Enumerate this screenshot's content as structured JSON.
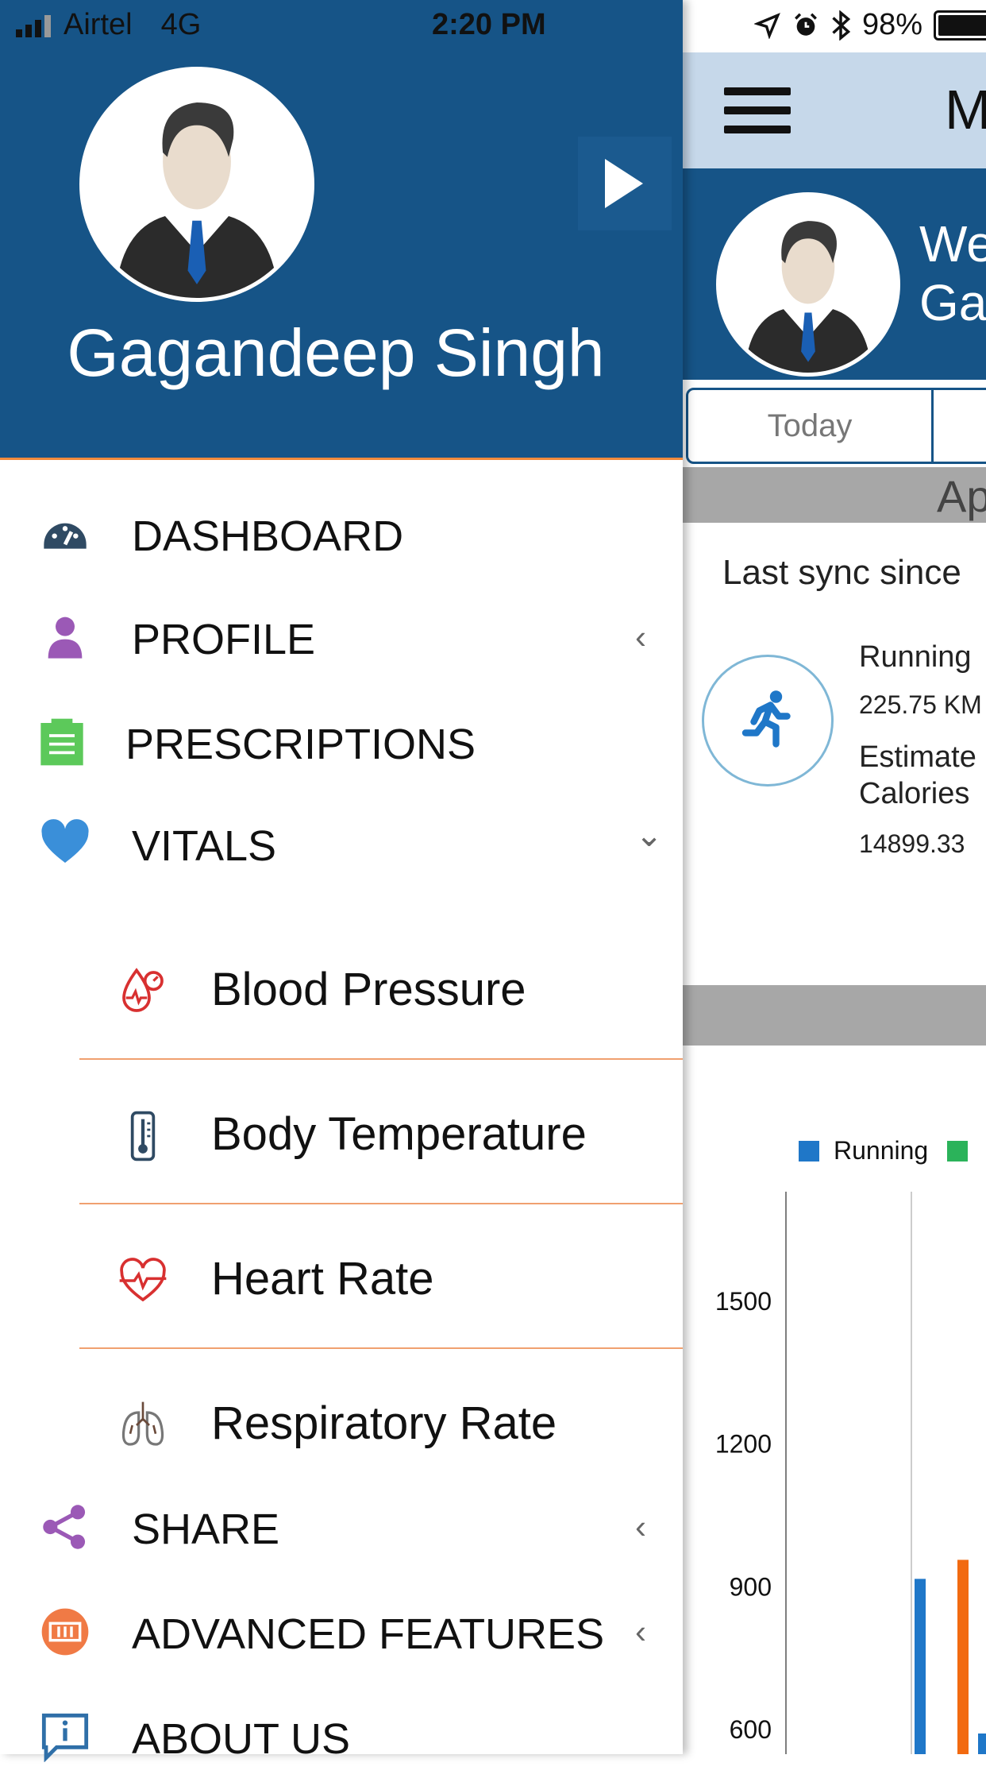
{
  "status_bar": {
    "carrier": "Airtel",
    "network": "4G",
    "time": "2:20 PM",
    "battery": "98%"
  },
  "drawer": {
    "user_name": "Gagandeep Singh",
    "menu": [
      {
        "label": "DASHBOARD",
        "icon": "dashboard-gauge-icon",
        "color": "#2f4a63"
      },
      {
        "label": "PROFILE",
        "icon": "person-icon",
        "color": "#9b59b6",
        "chevron": "‹"
      },
      {
        "label": "PRESCRIPTIONS",
        "icon": "clipboard-icon",
        "color": "#5cc95a"
      },
      {
        "label": "VITALS",
        "icon": "heart-icon",
        "color": "#3a8fd9",
        "chevron": "⌄"
      }
    ],
    "vitals_sub": [
      {
        "label": "Blood Pressure",
        "icon": "blood-pressure-icon"
      },
      {
        "label": "Body Temperature",
        "icon": "thermometer-icon"
      },
      {
        "label": "Heart Rate",
        "icon": "heart-rate-icon"
      },
      {
        "label": "Respiratory Rate",
        "icon": "lungs-icon"
      }
    ],
    "menu_bottom": [
      {
        "label": "SHARE",
        "icon": "share-icon",
        "color": "#9b59b6",
        "chevron": "‹"
      },
      {
        "label": "ADVANCED FEATURES",
        "icon": "advanced-features-icon",
        "color": "#f07a45",
        "chevron": "‹"
      },
      {
        "label": "ABOUT US",
        "icon": "info-icon",
        "color": "#2f6fa8"
      }
    ]
  },
  "main": {
    "title_partial": "M",
    "welcome_line1": "We",
    "welcome_line2": "Ga",
    "tab_today": "Today",
    "band_text": "Ap",
    "last_sync": "Last sync since",
    "running_label": "Running",
    "running_value": "225.75 KM",
    "estimated_label_1": "Estimate",
    "estimated_label_2": "Calories",
    "calories_value": "14899.33",
    "legend_running": "Running"
  },
  "colors": {
    "header_blue": "#165487",
    "accent_orange": "#f08a3c",
    "appbar_blue": "#c6d8ea",
    "running_blue": "#1f77c8",
    "series_orange": "#f26a10",
    "series_green": "#2bb35a"
  },
  "chart_data": {
    "type": "bar",
    "y_ticks": [
      600,
      900,
      1200,
      1500
    ],
    "series": [
      {
        "name": "Running",
        "values": [
          915
        ]
      },
      {
        "values": [
          955
        ]
      },
      {
        "values": [
          590
        ]
      }
    ]
  }
}
